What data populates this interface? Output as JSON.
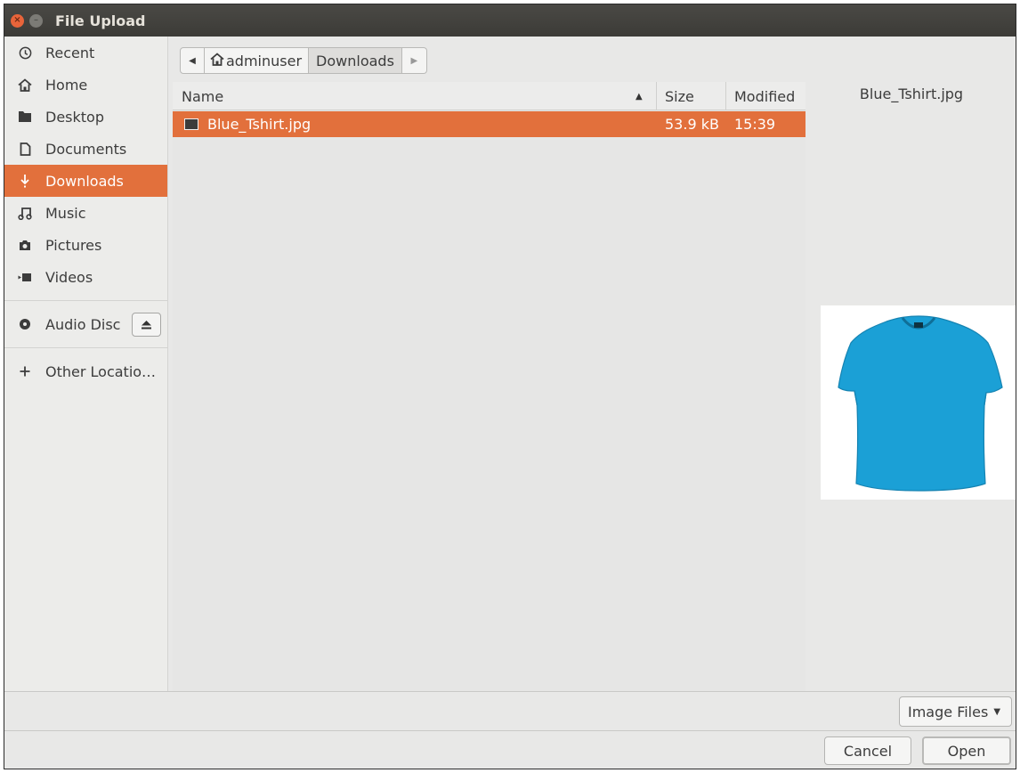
{
  "window": {
    "title": "File Upload"
  },
  "sidebar": {
    "items": [
      {
        "label": "Recent",
        "icon": "clock-icon",
        "active": false
      },
      {
        "label": "Home",
        "icon": "home-icon",
        "active": false
      },
      {
        "label": "Desktop",
        "icon": "folder-icon",
        "active": false
      },
      {
        "label": "Documents",
        "icon": "document-icon",
        "active": false
      },
      {
        "label": "Downloads",
        "icon": "download-icon",
        "active": true
      },
      {
        "label": "Music",
        "icon": "music-icon",
        "active": false
      },
      {
        "label": "Pictures",
        "icon": "camera-icon",
        "active": false
      },
      {
        "label": "Videos",
        "icon": "video-icon",
        "active": false
      }
    ],
    "devices": [
      {
        "label": "Audio Disc",
        "icon": "disc-icon",
        "action_icon": "eject-icon"
      }
    ],
    "other": {
      "label": "Other Locatio…",
      "icon": "plus-icon"
    }
  },
  "pathbar": {
    "segments": [
      {
        "label": "adminuser",
        "icon": "home-icon"
      },
      {
        "label": "Downloads"
      }
    ]
  },
  "filelist": {
    "columns": {
      "name": "Name",
      "size": "Size",
      "modified": "Modified"
    },
    "sort": {
      "column": "name",
      "direction": "ascending"
    },
    "rows": [
      {
        "name": "Blue_Tshirt.jpg",
        "size": "53.9 kB",
        "modified": "15:39",
        "icon": "image-file-icon",
        "selected": true
      }
    ]
  },
  "preview": {
    "filename": "Blue_Tshirt.jpg",
    "image_subject": "blue t-shirt"
  },
  "filter": {
    "selected": "Image Files"
  },
  "buttons": {
    "cancel": "Cancel",
    "open": "Open"
  },
  "colors": {
    "accent": "#e2703c",
    "titlebar": "#3c3b37",
    "tshirt": "#1ba0d6"
  }
}
